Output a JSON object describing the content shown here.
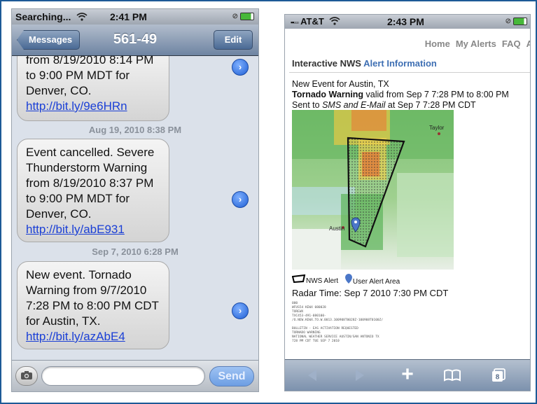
{
  "left_phone": {
    "status": {
      "carrier": "Searching...",
      "time": "2:41 PM"
    },
    "nav": {
      "back_label": "Messages",
      "title": "561-49",
      "edit_label": "Edit"
    },
    "messages": [
      {
        "lines": [
          "from 8/19/2010 8:14 PM",
          "to 9:00 PM MDT for",
          "Denver, CO."
        ],
        "link": "http://bit.ly/9e6HRn"
      },
      {
        "lines": [
          "Event cancelled. Severe",
          "Thunderstorm Warning",
          "from 8/19/2010 8:37 PM",
          "to 9:00 PM MDT for",
          "Denver, CO."
        ],
        "link": "http://bit.ly/abE931"
      },
      {
        "lines": [
          "New event. Tornado",
          "Warning from 9/7/2010",
          "7:28 PM to 8:00 PM CDT",
          "for Austin, TX."
        ],
        "link": "http://bit.ly/azAbE4"
      }
    ],
    "timestamps": [
      "Aug 19, 2010 8:38 PM",
      "Sep 7, 2010 6:28 PM"
    ],
    "input": {
      "placeholder": "",
      "send_label": "Send"
    }
  },
  "right_phone": {
    "status": {
      "carrier": "AT&T",
      "time": "2:43 PM"
    },
    "top_nav": [
      "Home",
      "My Alerts",
      "FAQ",
      "A"
    ],
    "site_title_bold": "Interactive NWS",
    "site_title_blue": "Alert Information",
    "event_line1": "New Event for Austin, TX",
    "event_warning": "Tornado Warning",
    "event_line2_rest": " valid from Sep 7 7:28 PM to 8:00 PM",
    "event_sent_prefix": "Sent to ",
    "event_sent_channels": "SMS and E-Mail",
    "event_sent_suffix": " at Sep 7 7:28 PM CDT",
    "map_labels": {
      "city1": "Taylor",
      "city2": "Austin"
    },
    "legend": {
      "alert": "NWS Alert",
      "user": "User Alert Area"
    },
    "radar_time": "Radar Time: Sep 7 2010 7:30 PM CDT",
    "fine_print": "000\nWFUS54 KEWX 080028\nTOREWX\nTXC453-491-080100-\n/O.NEW.KEWX.TO.W.0013.100908T0028Z-100908T0100Z/\n\nBULLETIN - EAS ACTIVATION REQUESTED\nTORNADO WARNING\nNATIONAL WEATHER SERVICE AUSTIN/SAN ANTONIO TX\n728 PM CDT TUE SEP 7 2010",
    "tabs_badge": "8"
  }
}
